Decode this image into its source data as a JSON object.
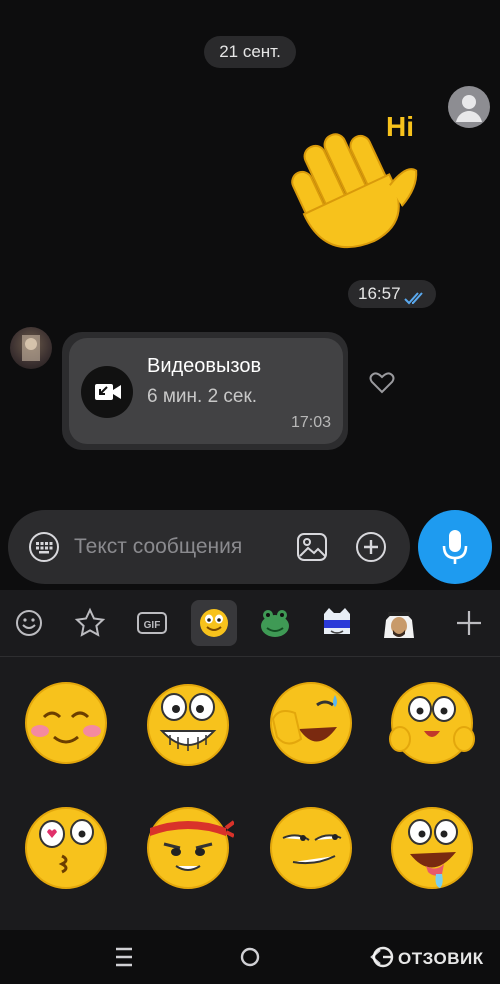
{
  "chat": {
    "date_separator": "21 сент.",
    "sent_sticker": {
      "text": "Hi",
      "time": "16:57"
    },
    "call_message": {
      "title": "Видеовызов",
      "duration": "6 мин.  2 сек.",
      "time": "17:03"
    }
  },
  "composer": {
    "placeholder": "Текст сообщения"
  },
  "sticker_panel": {
    "tabs": [
      "emoji-tab",
      "favorites-tab",
      "gif-tab",
      "smiley-pack-tab",
      "frog-pack-tab",
      "cat-pack-tab",
      "sheikh-pack-tab",
      "add-pack-tab"
    ],
    "gif_label": "GIF",
    "active_tab": "smiley-pack-tab"
  },
  "watermark": "ОТЗОВИК",
  "colors": {
    "accent_blue": "#1e9bf0",
    "background": "#0d0d0e",
    "bubble": "#2c2c2e",
    "sticker_yellow": "#f7c21c"
  }
}
